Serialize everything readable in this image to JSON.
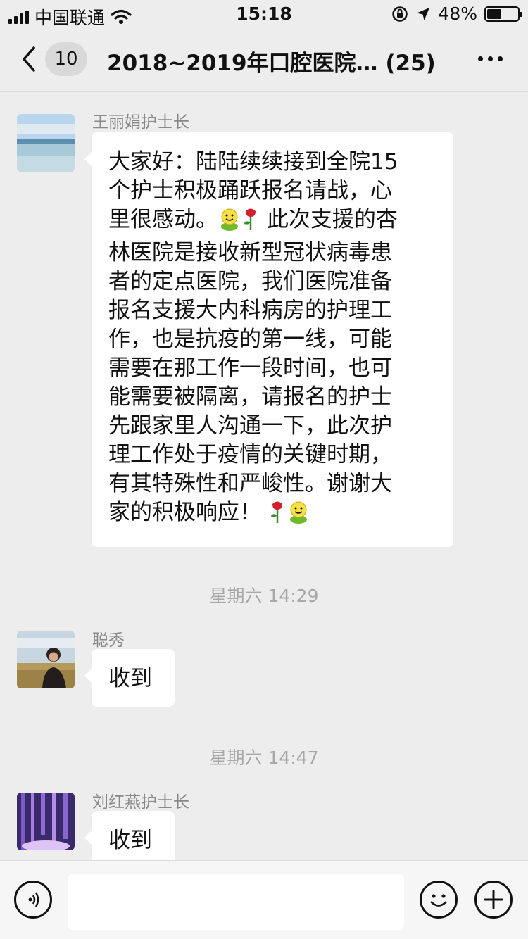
{
  "status_bar": {
    "carrier": "中国联通",
    "time": "15:18",
    "battery_text": "48%",
    "battery_level": 0.48
  },
  "nav": {
    "unread_count": "10",
    "title": "2018~2019年口腔医院… (25)"
  },
  "messages": [
    {
      "sender": "王丽娟护士长",
      "segments": [
        "大家好：陆陆续续接到全院15\n个护士积极踊跃报名请战，心\n里很感动。",
        " 此次支援的杏\n林医院是接收新型冠状病毒患\n者的定点医院，我们医院准备\n报名支援大内科病房的护理工\n作，也是抗疫的第一线，可能\n需要在那工作一段时间，也可\n能需要被隔离，请报名的护士\n先跟家里人沟通一下，此次护\n理工作处于疫情的关键时期，\n有其特殊性和严峻性。谢谢大\n家的积极响应！"
      ],
      "emojis": [
        "smile-emoji",
        "rose-emoji",
        "rose-emoji",
        "smile-emoji"
      ]
    },
    {
      "timestamp": "星期六 14:29"
    },
    {
      "sender": "聪秀",
      "text": "收到"
    },
    {
      "timestamp": "星期六 14:47"
    },
    {
      "sender": "刘红燕护士长",
      "text": "收到"
    }
  ],
  "input_bar": {
    "voice_icon": "voice-icon",
    "emoji_icon": "emoji-icon",
    "plus_icon": "plus-icon",
    "input_value": ""
  },
  "colors": {
    "background": "#ededed",
    "bubble": "#ffffff",
    "sender_name": "#888888",
    "timestamp": "#a8a8a8"
  }
}
